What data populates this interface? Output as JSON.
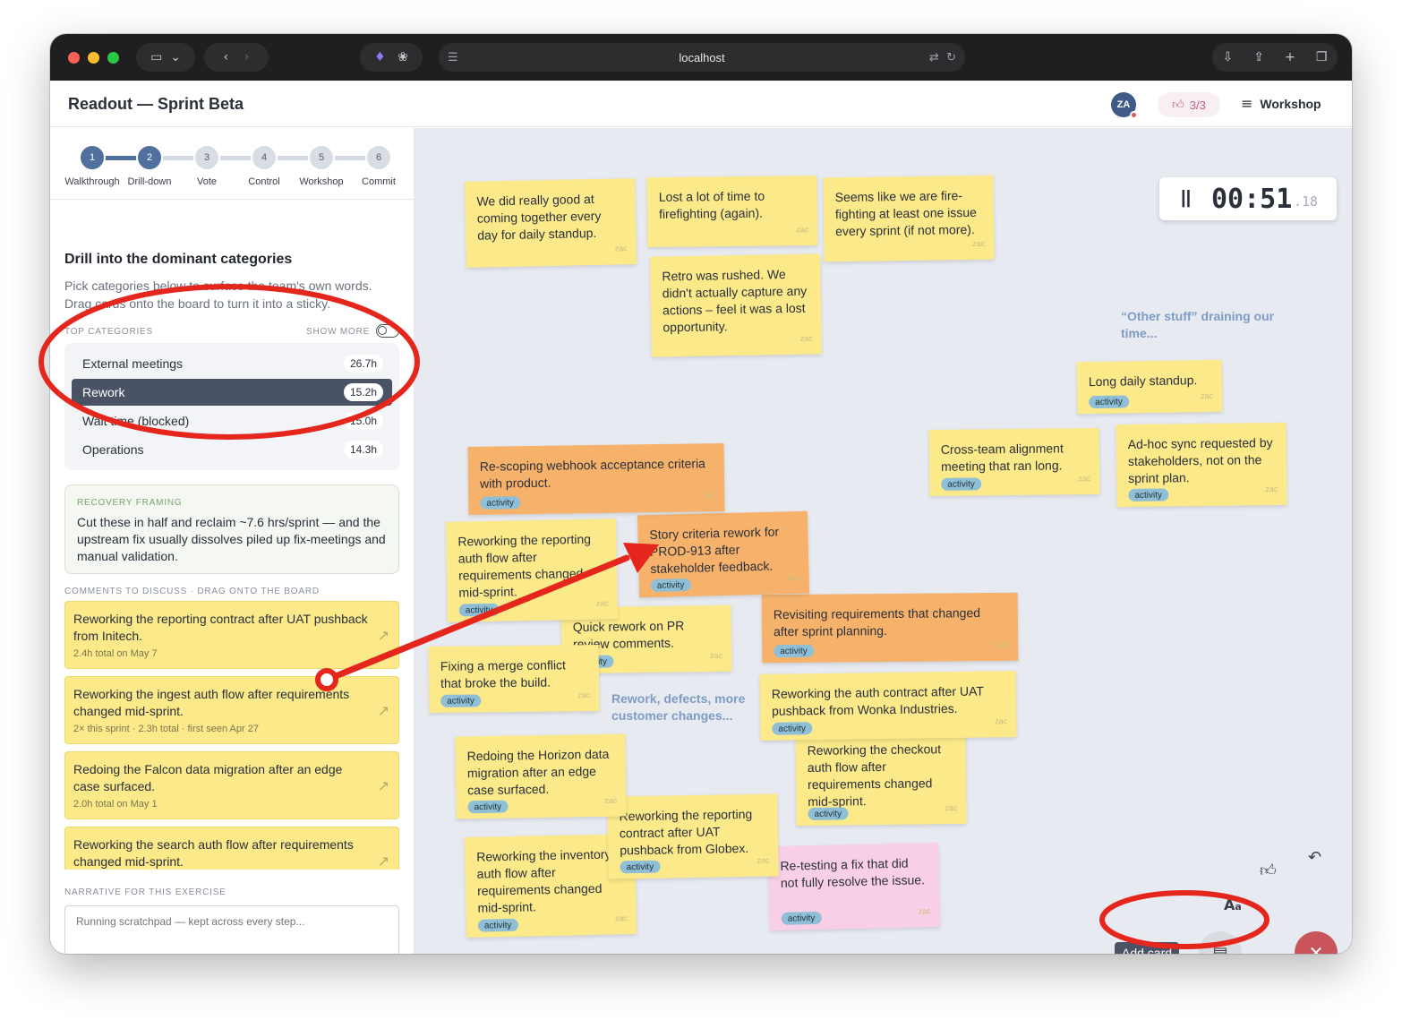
{
  "browser": {
    "url": "localhost",
    "icons": [
      "sidebar-icon",
      "chevron-down-icon",
      "back-icon",
      "forward-icon",
      "extension-icon",
      "paw-icon",
      "page-menu-icon",
      "translate-icon",
      "reload-icon",
      "download-icon",
      "share-icon",
      "new-tab-icon",
      "tabs-icon"
    ]
  },
  "header": {
    "title": "Readout — Sprint Beta",
    "avatar_initials": "ZA",
    "votes": "3/3",
    "workshop_label": "Workshop"
  },
  "steps": [
    {
      "num": "1",
      "label": "Walkthrough",
      "done": true
    },
    {
      "num": "2",
      "label": "Drill-down",
      "done": true
    },
    {
      "num": "3",
      "label": "Vote",
      "done": false
    },
    {
      "num": "4",
      "label": "Control",
      "done": false
    },
    {
      "num": "5",
      "label": "Workshop",
      "done": false
    },
    {
      "num": "6",
      "label": "Commit",
      "done": false
    }
  ],
  "sidebar": {
    "heading": "Drill into the dominant categories",
    "intro": "Pick categories below to surface the team's own words. Drag cards onto the board to turn it into a sticky.",
    "top_categories_caption": "TOP CATEGORIES",
    "show_more": "SHOW MORE",
    "categories": [
      {
        "label": "External meetings",
        "value": "26.7h",
        "selected": false
      },
      {
        "label": "Rework",
        "value": "15.2h",
        "selected": true
      },
      {
        "label": "Wait time (blocked)",
        "value": "15.0h",
        "selected": false
      },
      {
        "label": "Operations",
        "value": "14.3h",
        "selected": false
      }
    ],
    "recovery_caption": "RECOVERY FRAMING",
    "recovery_text": "Cut these in half and reclaim ~7.6 hrs/sprint — and the upstream fix usually dissolves piled up fix-meetings and manual validation.",
    "comments_caption": "COMMENTS TO DISCUSS · DRAG ONTO THE BOARD",
    "comments": [
      {
        "text": "Reworking the reporting contract after UAT pushback from Initech.",
        "meta": "2.4h total on May 7"
      },
      {
        "text": "Reworking the ingest auth flow after requirements changed mid-sprint.",
        "meta": "2× this sprint · 2.3h total · first seen Apr 27"
      },
      {
        "text": "Redoing the Falcon data migration after an edge case surfaced.",
        "meta": "2.0h total on May 1"
      },
      {
        "text": "Reworking the search auth flow after requirements changed mid-sprint.",
        "meta": ""
      }
    ],
    "narrative_caption": "NARRATIVE FOR THIS EXERCISE",
    "narrative_placeholder": "Running scratchpad — kept across every step..."
  },
  "board": {
    "timer": {
      "pause_icon": "pause-icon",
      "time": "00:51",
      "fraction": ".18"
    },
    "groups": [
      {
        "text": "“Other stuff” draining our time..."
      },
      {
        "text": "Rework, defects, more customer changes..."
      }
    ],
    "stickies": [
      {
        "text": "We did really good at coming together every day for daily standup.",
        "author": "zac",
        "tag": "",
        "color": "#fbe98a"
      },
      {
        "text": "Lost a lot of time to firefighting (again).",
        "author": "zac",
        "tag": "",
        "color": "#fbe98a"
      },
      {
        "text": "Seems like we are fire-fighting at least one issue every sprint (if not more).",
        "author": "zac",
        "tag": "",
        "color": "#fbe98a"
      },
      {
        "text": "Retro was rushed. We didn't actually capture any actions – feel it was a lost opportunity.",
        "author": "zac",
        "tag": "",
        "color": "#fbe98a"
      },
      {
        "text": "Long daily standup.",
        "author": "zac",
        "tag": "activity",
        "color": "#fbe98a"
      },
      {
        "text": "Cross-team alignment meeting that ran long.",
        "author": "zac",
        "tag": "activity",
        "color": "#fbe98a"
      },
      {
        "text": "Ad-hoc sync requested by stakeholders, not on the sprint plan.",
        "author": "zac",
        "tag": "activity",
        "color": "#fbe98a"
      },
      {
        "text": "Re-scoping webhook acceptance criteria with product.",
        "author": "zac",
        "tag": "activity",
        "color": "#f6b26b"
      },
      {
        "text": "Reworking the reporting auth flow after requirements changed mid-sprint.",
        "author": "zac",
        "tag": "activity",
        "color": "#fbe98a"
      },
      {
        "text": "Story criteria rework for PROD-913 after stakeholder feedback.",
        "author": "zac",
        "tag": "activity",
        "color": "#f6b26b"
      },
      {
        "text": "Fixing a merge conflict that broke the build.",
        "author": "zac",
        "tag": "activity",
        "color": "#fbe98a"
      },
      {
        "text": "Quick rework on PR review comments.",
        "author": "zac",
        "tag": "activity",
        "color": "#fbe98a"
      },
      {
        "text": "Revisiting requirements that changed after sprint planning.",
        "author": "zac",
        "tag": "activity",
        "color": "#f6b26b"
      },
      {
        "text": "Reworking the auth contract after UAT pushback from Wonka Industries.",
        "author": "zac",
        "tag": "activity",
        "color": "#fbe98a"
      },
      {
        "text": "Reworking the checkout auth flow after requirements changed mid-sprint.",
        "author": "zac",
        "tag": "activity",
        "color": "#fbe98a"
      },
      {
        "text": "Redoing the Horizon data migration after an edge case surfaced.",
        "author": "zac",
        "tag": "activity",
        "color": "#fbe98a"
      },
      {
        "text": "Reworking the reporting contract after UAT pushback from Globex.",
        "author": "zac",
        "tag": "activity",
        "color": "#fbe98a"
      },
      {
        "text": "Reworking the inventory auth flow after requirements changed mid-sprint.",
        "author": "zac",
        "tag": "activity",
        "color": "#fbe98a"
      },
      {
        "text": "Re-testing a fix that did not fully resolve the issue.",
        "author": "zac",
        "tag": "activity",
        "color": "#f8cfe6"
      }
    ],
    "tools": {
      "like_icon": "thumbs-up-icon",
      "undo_icon": "undo-icon",
      "font_icon": "font-size-icon"
    },
    "add_card_label": "Add card",
    "note_icon": "note-icon",
    "close_icon": "close-icon"
  },
  "annotation_color": "#e5261c"
}
